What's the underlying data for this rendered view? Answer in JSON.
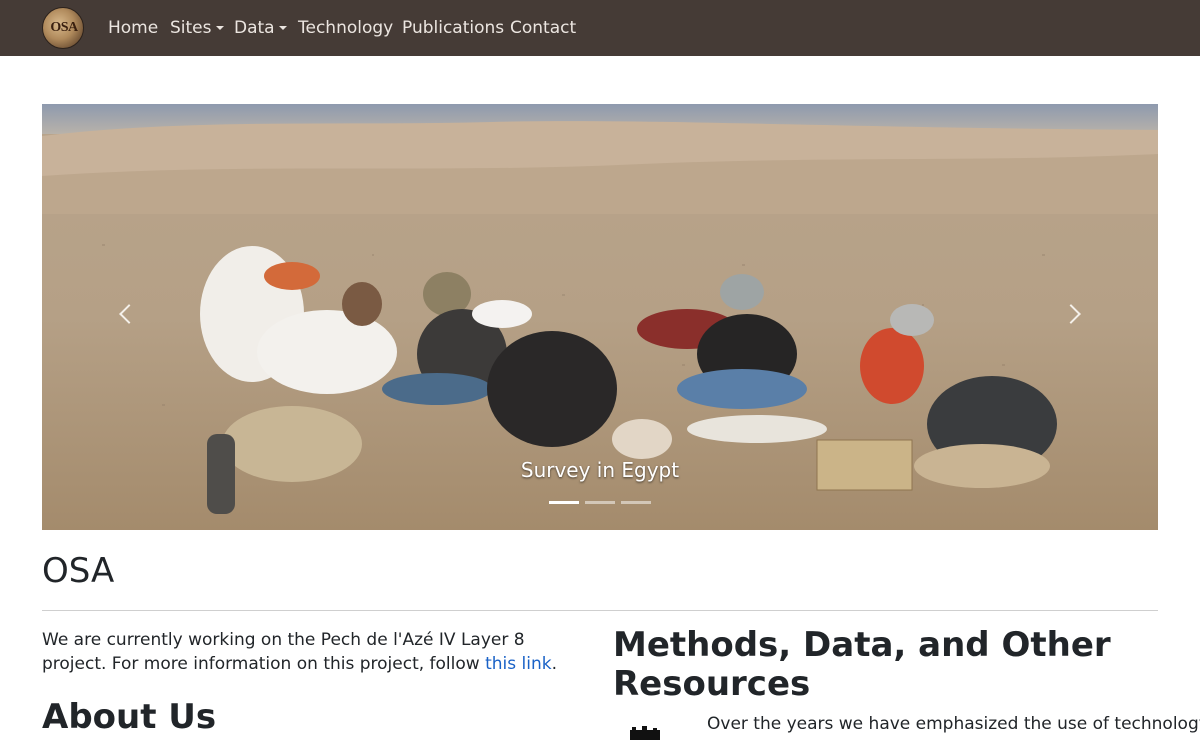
{
  "navbar": {
    "logo_text": "OSA",
    "items": [
      {
        "label": "Home",
        "dropdown": false
      },
      {
        "label": "Sites",
        "dropdown": true
      },
      {
        "label": "Data",
        "dropdown": true
      },
      {
        "label": "Technology",
        "dropdown": false
      },
      {
        "label": "Publications",
        "dropdown": false
      },
      {
        "label": "Contact",
        "dropdown": false
      }
    ]
  },
  "carousel": {
    "caption": "Survey in Egypt",
    "slide_count": 3,
    "active_index": 0,
    "prev_icon": "chevron-left-icon",
    "next_icon": "chevron-right-icon"
  },
  "main": {
    "title": "OSA",
    "intro_text": "We are currently working on the Pech de l'Azé IV Layer 8 project. For more information on this project, follow ",
    "intro_link": "this link",
    "intro_end": ".",
    "about_heading": "About Us",
    "methods_heading": "Methods, Data, and Other Resources",
    "methods_text": "Over the years we have emphasized the use of technology"
  },
  "colors": {
    "navbar_bg": "#453b36",
    "link": "#1a62c7",
    "text": "#212529"
  }
}
